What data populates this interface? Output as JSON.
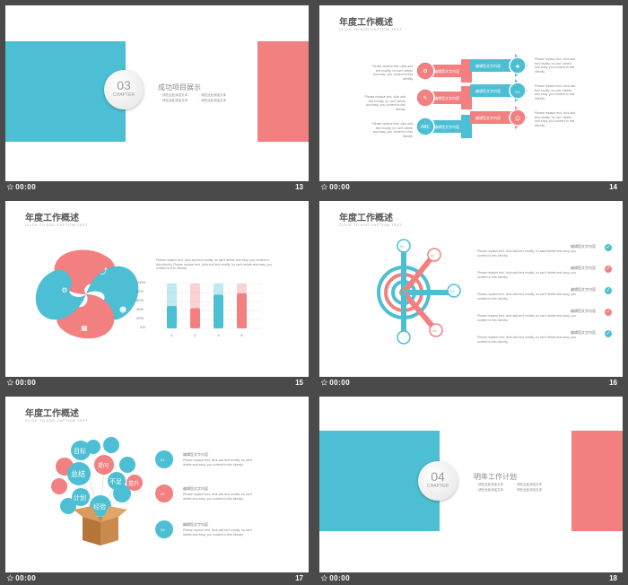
{
  "slides": [
    {
      "number": "13",
      "time": "00:00",
      "chapter_no": "03",
      "chapter_word": "CHAPTER",
      "title": "成功项目展示",
      "bullets": [
        "·  请在此处添加文本",
        "·  请在此处添加文本",
        "·  请在此处添加文本",
        "·  请在此处添加文本"
      ]
    },
    {
      "number": "14",
      "time": "00:00",
      "title": "年度工作概述",
      "subtitle": "CLICK TO ADD CAPTION TEXT",
      "arrow_label": "编辑您文字内容",
      "para": "Please replace text, click add text modify, ho can't delete and easy, you content to this directly"
    },
    {
      "number": "15",
      "time": "00:00",
      "title": "年度工作概述",
      "subtitle": "CLICK TO ADD CAPTION TEXT",
      "para": "Please replace text, click add text modify, ho can't delete and easy, you content to this directly. Please replace text, click add text modify, ho can't delete and easy, you content to this directly.",
      "yticks": [
        "100%",
        "80%",
        "60%",
        "40%",
        "20%",
        "0%"
      ],
      "xticks": [
        "1",
        "2",
        "3",
        "4"
      ]
    },
    {
      "number": "16",
      "time": "00:00",
      "title": "年度工作概述",
      "subtitle": "CLICK TO ADD CAPTION TEXT",
      "item_label": "编辑您文字内容",
      "para": "Please replace text, click add text modify, ho can't delete and easy, you content to this directly.",
      "nodes": [
        "01",
        "02",
        "03",
        "04"
      ]
    },
    {
      "number": "17",
      "time": "00:00",
      "title": "年度工作概述",
      "subtitle": "CLICK TO ADD CAPTION TEXT",
      "balloons": [
        "目标",
        "提问",
        "总结",
        "不足",
        "提升",
        "计划",
        "经验"
      ],
      "items": [
        "01",
        "02",
        "03"
      ],
      "item_label": "编辑您文字内容",
      "para": "Please replace text, click add text modify, ho can't delete and easy, you content to this directly."
    },
    {
      "number": "18",
      "time": "00:00",
      "chapter_no": "04",
      "chapter_word": "CHAPTER",
      "title": "明年工作计划",
      "bullets": [
        "·  请在此处添加文本",
        "·  请在此处添加文本",
        "·  请在此处添加文本",
        "·  请在此处添加文本"
      ]
    }
  ],
  "chart_data": {
    "type": "bar",
    "categories": [
      "1",
      "2",
      "3",
      "4"
    ],
    "series": [
      {
        "values": [
          50,
          45,
          75,
          78
        ]
      }
    ],
    "ylim": [
      0,
      100
    ],
    "yticks": [
      "100%",
      "80%",
      "60%",
      "40%",
      "20%",
      "0%"
    ]
  },
  "colors": {
    "teal": "#4dbfd4",
    "coral": "#f27e7e",
    "bg": "#4a4a4a"
  }
}
